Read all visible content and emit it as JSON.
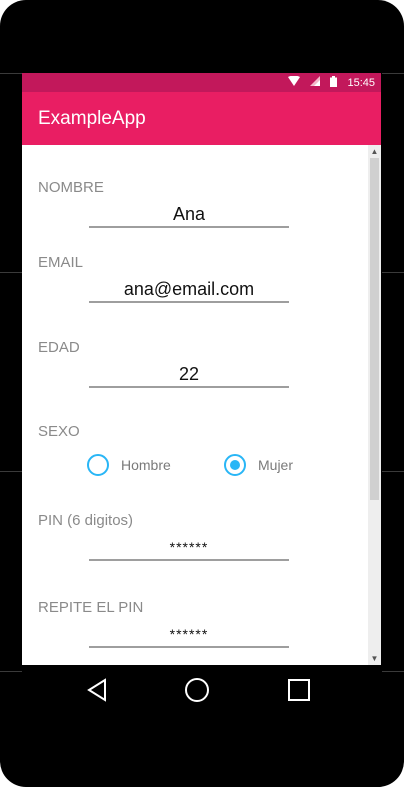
{
  "status_bar": {
    "time": "15:45",
    "icons": [
      "wifi-icon",
      "signal-icon",
      "battery-icon"
    ]
  },
  "app_bar": {
    "title": "ExampleApp"
  },
  "form": {
    "nombre": {
      "label": "NOMBRE",
      "value": "Ana"
    },
    "email": {
      "label": "EMAIL",
      "value": "ana@email.com"
    },
    "edad": {
      "label": "EDAD",
      "value": "22"
    },
    "sexo": {
      "label": "SEXO",
      "options": [
        {
          "label": "Hombre",
          "selected": false
        },
        {
          "label": "Mujer",
          "selected": true
        }
      ]
    },
    "pin": {
      "label": "PIN (6 digitos)",
      "value": "******"
    },
    "repite_pin": {
      "label": "REPITE EL PIN",
      "value": "******"
    }
  },
  "navigation": {
    "buttons": [
      "back-icon",
      "home-icon",
      "recent-apps-icon"
    ]
  },
  "colors": {
    "status_bar": "#c2185b",
    "app_bar": "#e91e63",
    "radio_accent": "#29b6f6"
  }
}
